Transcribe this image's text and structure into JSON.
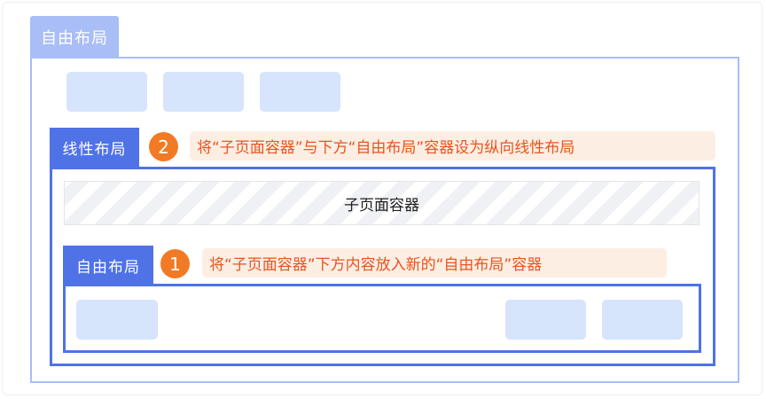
{
  "outer_layout": {
    "label": "自由布局"
  },
  "linear_layout": {
    "label": "线性布局"
  },
  "subpage_container": {
    "label": "子页面容器"
  },
  "inner_layout": {
    "label": "自由布局"
  },
  "steps": [
    {
      "number": "2",
      "text": "将“子页面容器”与下方“自由布局”容器设为纵向线性布局"
    },
    {
      "number": "1",
      "text": "将“子页面容器”下方内容放入新的“自由布局”容器"
    }
  ],
  "colors": {
    "outer_frame": "#a9bdf7",
    "linear_frame": "#4f72e6",
    "placeholder": "#d6e4fc",
    "step_badge": "#f27a24",
    "note_background": "#fdeee3",
    "note_text": "#e9541e"
  }
}
